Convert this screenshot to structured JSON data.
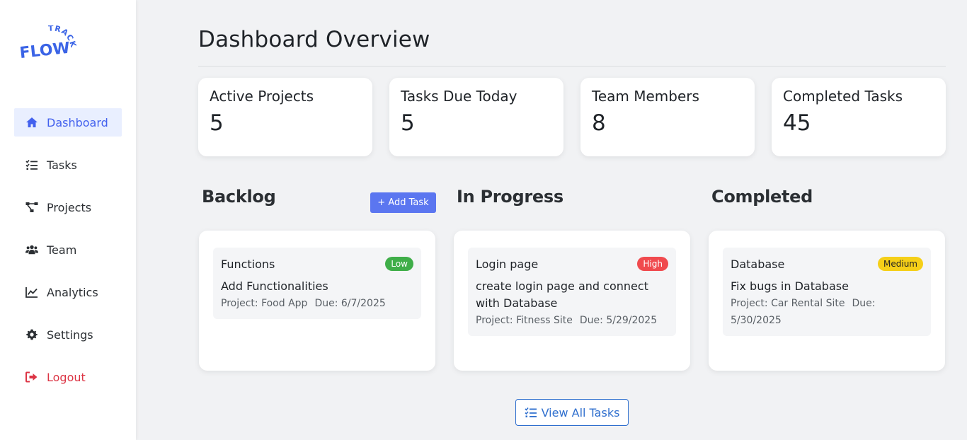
{
  "brand": {
    "logo_text_main": "FLOW",
    "logo_text_arc": "TRACK",
    "accent": "#4361ee"
  },
  "sidebar": {
    "items": [
      {
        "label": "Dashboard",
        "icon": "home-icon",
        "active": true
      },
      {
        "label": "Tasks",
        "icon": "task-list-icon"
      },
      {
        "label": "Projects",
        "icon": "project-tree-icon"
      },
      {
        "label": "Team",
        "icon": "users-icon"
      },
      {
        "label": "Analytics",
        "icon": "chart-line-icon"
      },
      {
        "label": "Settings",
        "icon": "gear-icon"
      },
      {
        "label": "Logout",
        "icon": "logout-icon",
        "color": "#dc3545"
      }
    ]
  },
  "main": {
    "title": "Dashboard Overview",
    "stats": [
      {
        "label": "Active Projects",
        "value": "5"
      },
      {
        "label": "Tasks Due Today",
        "value": "5"
      },
      {
        "label": "Team Members",
        "value": "8"
      },
      {
        "label": "Completed Tasks",
        "value": "45"
      }
    ],
    "columns": [
      {
        "title": "Backlog",
        "add_button": "+ Add Task",
        "tasks": [
          {
            "name": "Functions",
            "priority": "Low",
            "description": "Add Functionalities",
            "project": "Project: Food App",
            "due": "Due: 6/7/2025"
          }
        ]
      },
      {
        "title": "In Progress",
        "tasks": [
          {
            "name": "Login page",
            "priority": "High",
            "description": "create login page and connect with Database",
            "project": "Project: Fitness Site",
            "due": "Due: 5/29/2025"
          }
        ]
      },
      {
        "title": "Completed",
        "tasks": [
          {
            "name": "Database",
            "priority": "Medium",
            "description": "Fix bugs in Database",
            "project": "Project: Car Rental Site",
            "due": "Due: 5/30/2025"
          }
        ]
      }
    ],
    "view_all_label": "View All Tasks",
    "priority_colors": {
      "Low": "#3fae49",
      "High": "#f04a4e",
      "Medium": "#f5cf18"
    }
  }
}
